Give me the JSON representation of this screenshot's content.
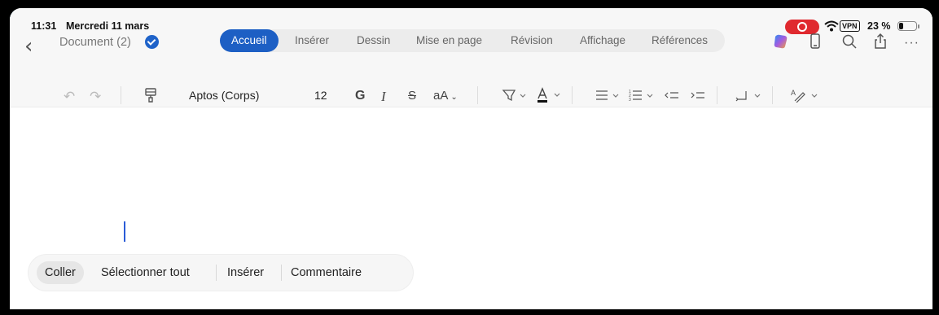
{
  "status_bar": {
    "time": "11:31",
    "date": "Mercredi 11 mars",
    "vpn": "VPN",
    "battery": "23 %",
    "record_color": "#e0292f"
  },
  "header": {
    "back_icon": "chevron-left-icon",
    "doc_title": "Document (2)",
    "tabs": [
      "Accueil",
      "Insérer",
      "Dessin",
      "Mise en page",
      "Révision",
      "Affichage",
      "Références"
    ],
    "active_tab": "Accueil",
    "accent": "#1d5fc4",
    "right_icons": [
      "copilot-icon",
      "phone-icon",
      "search-icon",
      "share-icon",
      "more-icon"
    ]
  },
  "toolbar": {
    "font_name": "Aptos (Corps)",
    "font_size": "12",
    "bold": "G",
    "italic": "I",
    "strikethrough": "S",
    "text_size": "aA"
  },
  "context_menu": {
    "items": [
      "Coller",
      "Sélectionner tout",
      "Insérer",
      "Commentaire"
    ]
  }
}
